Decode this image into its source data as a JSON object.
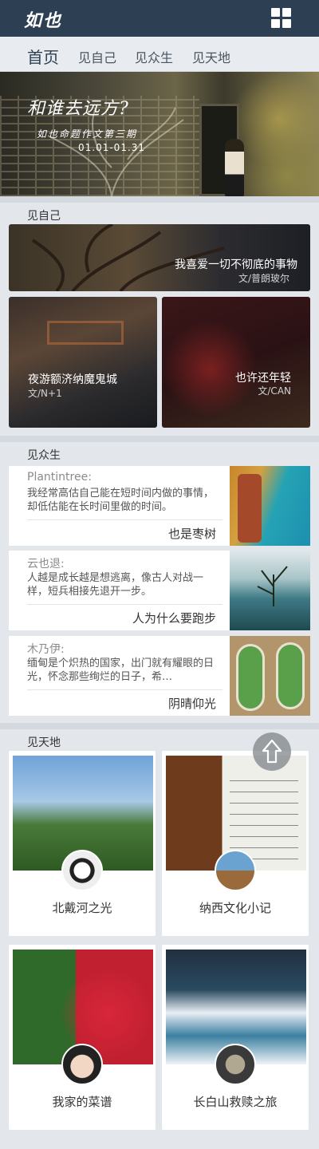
{
  "app": {
    "logo": "如也"
  },
  "nav": {
    "items": [
      "首页",
      "见自己",
      "见众生",
      "见天地"
    ],
    "active_index": 0
  },
  "hero": {
    "title": "和谁去远方?",
    "subtitle": "如也命题作文第三期",
    "date": "01.01-01.31"
  },
  "sections": {
    "self": {
      "title": "见自己",
      "items": [
        {
          "title": "我喜爱一切不彻底的事物",
          "author": "文/普朗玻尔"
        },
        {
          "title": "夜游额济纳魔鬼城",
          "author": "文/N+1"
        },
        {
          "title": "也许还年轻",
          "author": "文/CAN"
        }
      ]
    },
    "people": {
      "title": "见众生",
      "items": [
        {
          "who": "Plantintree:",
          "text": "我经常高估自己能在短时间内做的事情，却低估能在长时间里做的时间。",
          "title": "也是枣树"
        },
        {
          "who": "云也退:",
          "text": "人越是成长越是想逃离，像古人对战一样，短兵相接先退开一步。",
          "title": "人为什么要跑步"
        },
        {
          "who": "木乃伊:",
          "text": "缅甸是个炽热的国家，出门就有耀眼的日光，怀念那些绚烂的日子，希…",
          "title": "阴晴仰光"
        }
      ]
    },
    "world": {
      "title": "见天地",
      "items": [
        {
          "title": "北戴河之光"
        },
        {
          "title": "纳西文化小记"
        },
        {
          "title": "我家的菜谱"
        },
        {
          "title": "长白山救赎之旅"
        }
      ]
    }
  },
  "icons": {
    "menu": "grid-icon",
    "back_to_top": "arrow-up-icon"
  },
  "colors": {
    "header": "#2d3f52",
    "background": "#e3e7ec"
  }
}
